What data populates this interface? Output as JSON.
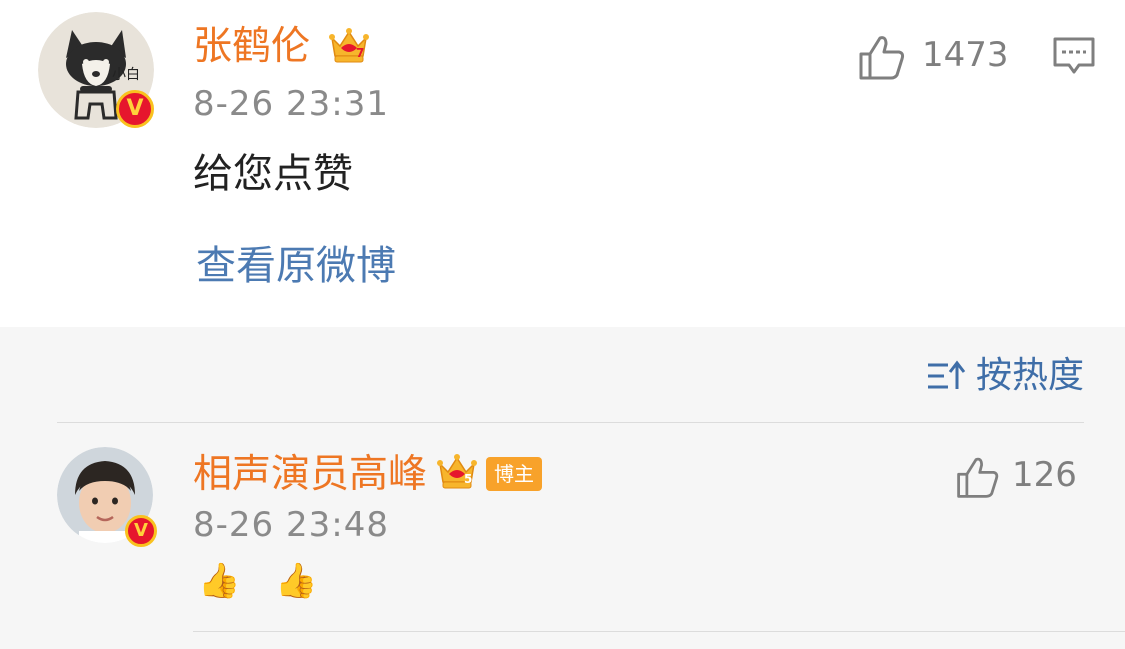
{
  "comment": {
    "username": "张鹤伦",
    "member_level": "7",
    "timestamp": "8-26 23:31",
    "text": "给您点赞",
    "view_original_label": "查看原微博",
    "like_count": "1473",
    "avatar_caption": "小白"
  },
  "replies_header": {
    "sort_label": "按热度"
  },
  "reply": {
    "username": "相声演员高峰",
    "member_level": "5",
    "author_badge": "博主",
    "timestamp": "8-26 23:48",
    "text": "👍 👍",
    "like_count": "126"
  },
  "colors": {
    "username": "#ee7623",
    "link": "#4c7ab2",
    "timestamp": "#8a8a8a",
    "verified_badge": "#e6162d",
    "author_badge": "#f8a22a",
    "reply_background": "#f6f6f6"
  }
}
